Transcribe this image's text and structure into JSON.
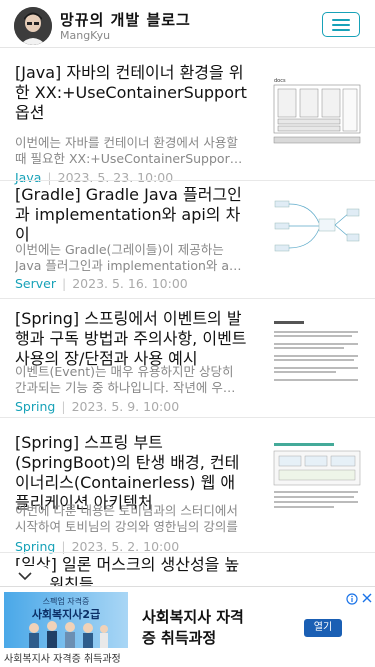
{
  "header": {
    "title": "망뀨의 개발 블로그",
    "subtitle": "MangKyu"
  },
  "posts": [
    {
      "title": "[Java] 자바의 컨테이너 환경을 위한 XX:+UseContainerSupport 옵션",
      "excerpt": "이번에는 자바를 컨테이너 환경에서 사용할 때 필요한 XX:+UseContainerSupport 옵션에 대해 알아보도록 하겠습니다.",
      "category": "Java",
      "date": "2023. 5. 23. 10:00"
    },
    {
      "title": "[Gradle] Gradle Java 플러그인과 implementation와 api의 차이",
      "excerpt": "이번에는 Gradle(그레이들)이 제공하는 Java 플러그인과 implementation와 api의 차이에 대해 알아보도록 하겠습니다.",
      "category": "Server",
      "date": "2023. 5. 16. 10:00"
    },
    {
      "title": "[Spring] 스프링에서 이벤트의 발행과 구독 방법과 주의사항, 이벤트 사용의 장/단점과 사용 예시",
      "excerpt": "이벤트(Event)는 매우 유용하지만 상당히 간과되는 기능 중 하나입니다. 작년에 우아한 테크코스에서 프로젝트를",
      "category": "Spring",
      "date": "2023. 5. 9. 10:00"
    },
    {
      "title": "[Spring] 스프링 부트(SpringBoot)의 탄생 배경, 컨테이너리스(Containerless) 웹 애플리케이션 아키텍처",
      "excerpt": "이번에 다룬 내용은 토비님과의 스터디에서 시작하여 토비님의 강의와 영한님의 강의를",
      "category": "Spring",
      "date": "2023. 5. 2. 10:00"
    },
    {
      "title": "[일상] 일론 머스크의 생산성을 높이는 원칙들"
    }
  ],
  "ad": {
    "banner_top": "스펙업 자격증",
    "banner_main": "사회복지사2급",
    "headline": "사회복지사 자격증 취득과정",
    "cta": "열기",
    "footer": "사회복지사 자격증 취득과정"
  },
  "colors": {
    "accent": "#17a2b8",
    "ad_cta": "#1a5fb4"
  },
  "icons": [
    "hamburger-menu-icon",
    "chevron-down-icon",
    "ad-info-icon",
    "close-icon"
  ]
}
